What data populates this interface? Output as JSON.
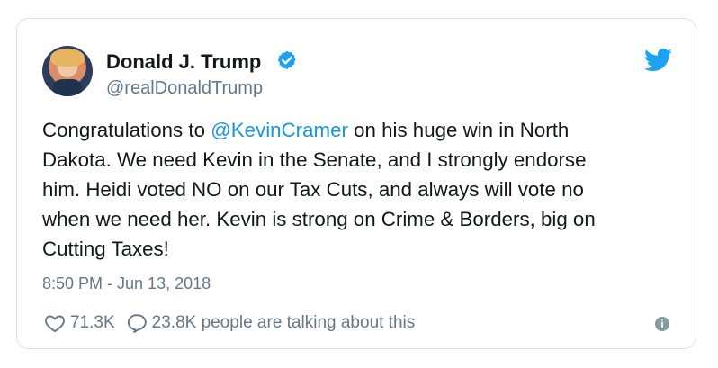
{
  "tweet": {
    "author_name": "Donald J. Trump",
    "author_handle": "@realDonaldTrump",
    "text_before": "Congratulations to ",
    "mention": "@KevinCramer",
    "text_after": " on his huge win in North\nDakota. We need Kevin in the Senate, and I strongly endorse\nhim. Heidi voted NO on our Tax Cuts, and always will vote no\nwhen we need her. Kevin is strong on Crime & Borders, big on\nCutting Taxes!",
    "timestamp": "8:50 PM - Jun 13, 2018",
    "likes": "71.3K",
    "talking": "23.8K people are talking about this",
    "info_glyph": "i"
  },
  "icons": {
    "verified": "verified-badge-icon",
    "brand": "twitter-bird-icon",
    "like": "heart-icon",
    "reply": "speech-bubble-icon",
    "info": "info-icon"
  },
  "colors": {
    "link": "#1b95e0",
    "text": "#14171a",
    "muted": "#657786",
    "brand": "#1da1f2"
  }
}
